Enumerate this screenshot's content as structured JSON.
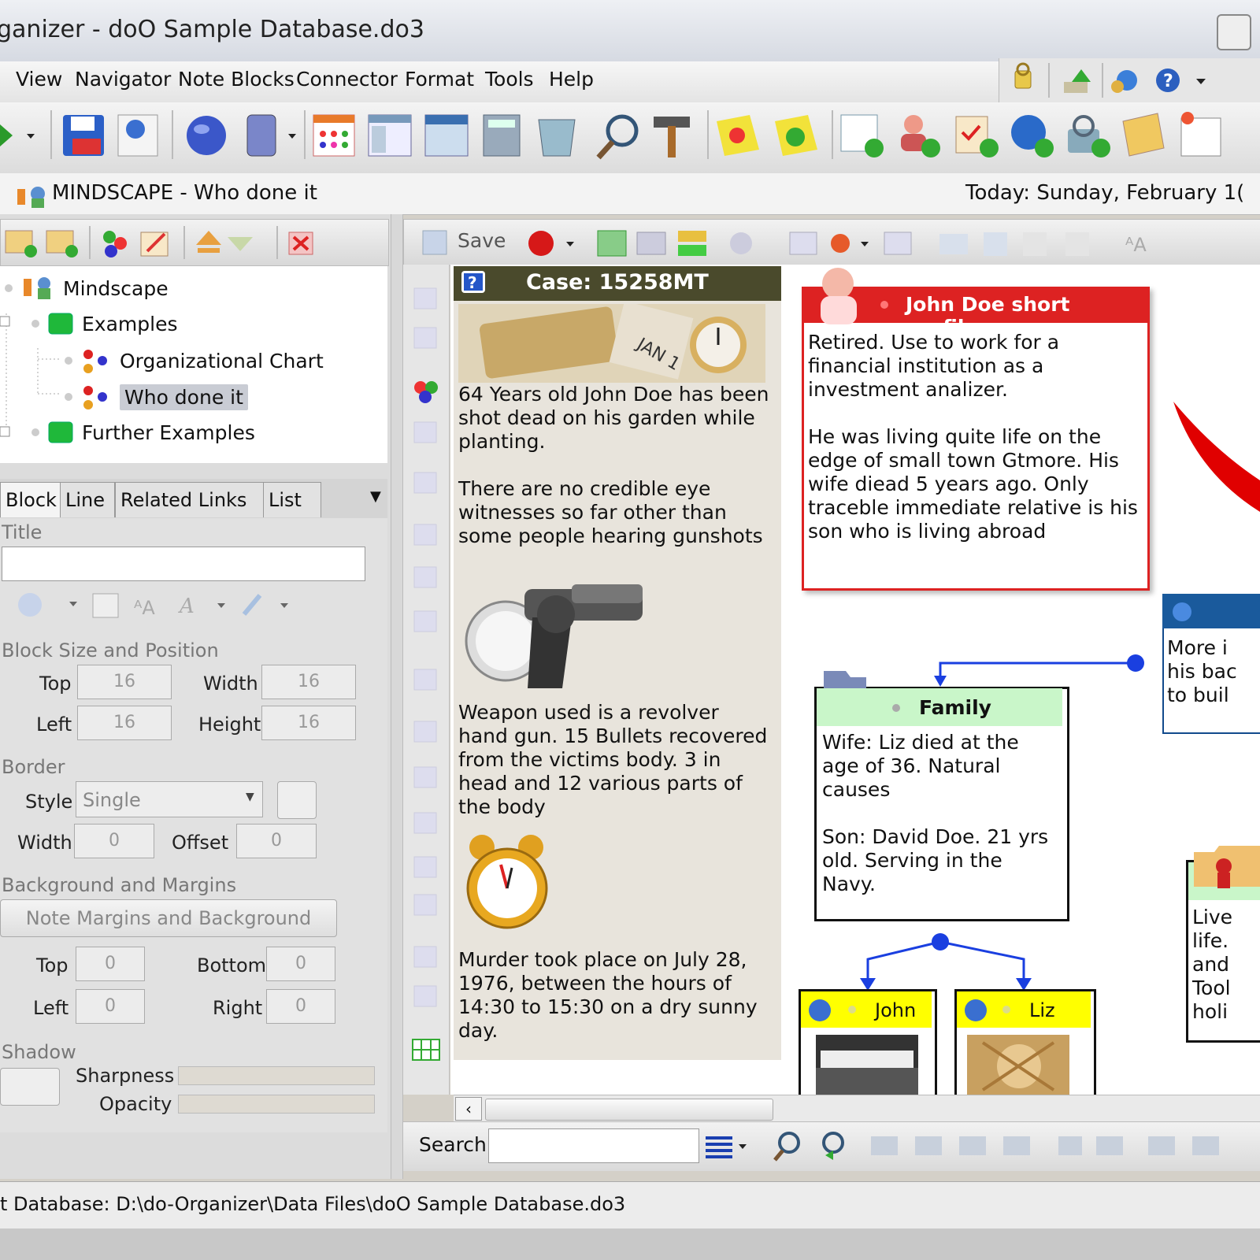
{
  "window": {
    "title": "ganizer - doO Sample Database.do3"
  },
  "menu": {
    "items": [
      "View",
      "Navigator",
      "Note Blocks",
      "Connector",
      "Format",
      "Tools",
      "Help"
    ]
  },
  "pathbar": {
    "database_name": "MINDSCAPE - Who done it",
    "today": "Today: Sunday, February 1("
  },
  "tree": {
    "root": "Mindscape",
    "items": [
      {
        "label": "Examples"
      },
      {
        "label": "Organizational Chart"
      },
      {
        "label": "Who done it"
      },
      {
        "label": "Further Examples"
      }
    ]
  },
  "tabs": [
    "Block",
    "Line",
    "Related Links",
    "List"
  ],
  "props": {
    "title_label": "Title",
    "title_value": "",
    "size_group": "Block Size and Position",
    "top_label": "Top",
    "top_value": "16",
    "width_label": "Width",
    "width_value": "16",
    "left_label": "Left",
    "left_value": "16",
    "height_label": "Height",
    "height_value": "16",
    "border_group": "Border",
    "style_label": "Style",
    "style_value": "Single",
    "bwidth_label": "Width",
    "bwidth_value": "0",
    "offset_label": "Offset",
    "offset_value": "0",
    "bg_group": "Background and Margins",
    "bg_button": "Note Margins and Background",
    "mtop_label": "Top",
    "mtop_value": "0",
    "mbottom_label": "Bottom",
    "mbottom_value": "0",
    "mleft_label": "Left",
    "mleft_value": "0",
    "mright_label": "Right",
    "mright_value": "0",
    "shadow_group": "Shadow",
    "sharpness_label": "Sharpness",
    "opacity_label": "Opacity"
  },
  "canvas_toolbar": {
    "save_label": "Save"
  },
  "notes": {
    "case": {
      "title": "Case: 15258MT",
      "p1": "64 Years old John Doe has been shot dead on his garden while planting.",
      "p2": "There are no credible eye witnesses so far other than some people hearing gunshots",
      "p3": "Weapon used is a revolver hand gun. 15 Bullets recovered from the victims body. 3 in head and 12 various parts of the body",
      "p4": "Murder took place on July 28, 1976,  between the hours of 14:30 to 15:30 on a dry sunny day."
    },
    "john_profile": {
      "title": "John Doe short profile",
      "p1": "Retired. Use to work for a financial institution as a investment analizer.",
      "p2": "He was living quite life on the edge of small town Gtmore. His wife diead 5 years ago. Only traceble immediate relative is his son who is living abroad"
    },
    "family": {
      "title": "Family",
      "p1": "Wife: Liz died at the age of 36. Natural causes",
      "p2": "Son: David Doe. 21 yrs old. Serving in the Navy."
    },
    "more": {
      "lines": [
        "More i",
        "his bac",
        "to buil"
      ]
    },
    "live": {
      "lines": [
        "Live",
        "life.",
        "and",
        "Tool",
        "holi"
      ]
    },
    "john": {
      "title": "John"
    },
    "liz": {
      "title": "Liz"
    }
  },
  "search": {
    "label": "Search",
    "value": ""
  },
  "status": {
    "text": "t Database: D:\\do-Organizer\\Data Files\\doO Sample Database.do3"
  },
  "colors": {
    "accent_red": "#dd2222",
    "connector_blue": "#1a3fe0",
    "family_header": "#c9f6c9",
    "person_header": "#ffff00"
  },
  "icons": [
    "save-icon",
    "settings-icon",
    "globe-icon",
    "search-icon",
    "hammer-icon",
    "calendar-icon",
    "trash-icon"
  ]
}
